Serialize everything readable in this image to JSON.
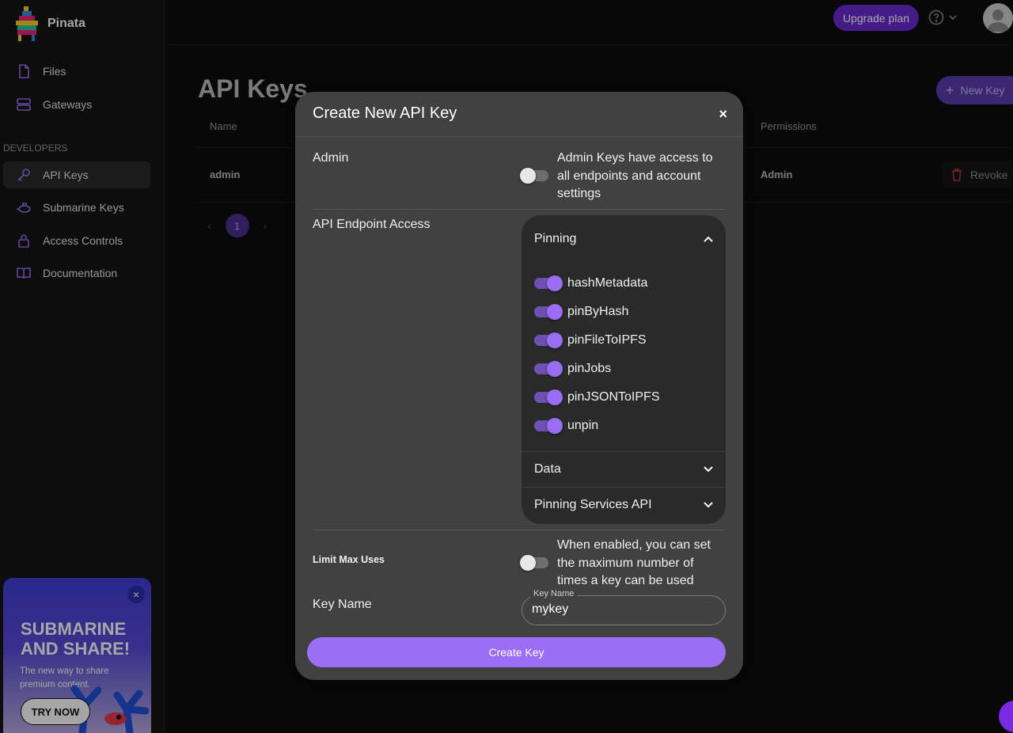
{
  "app": {
    "name": "Pinata",
    "upgrade_label": "Upgrade plan"
  },
  "sidebar": {
    "items": [
      {
        "label": "Files",
        "icon": "file-icon"
      },
      {
        "label": "Gateways",
        "icon": "server-icon"
      }
    ],
    "section_label": "DEVELOPERS",
    "dev_items": [
      {
        "label": "API Keys",
        "icon": "key-icon",
        "active": true
      },
      {
        "label": "Submarine Keys",
        "icon": "submarine-icon"
      },
      {
        "label": "Access Controls",
        "icon": "lock-icon"
      },
      {
        "label": "Documentation",
        "icon": "book-icon"
      }
    ]
  },
  "promo": {
    "title_line1": "SUBMARINE",
    "title_line2": "AND SHARE!",
    "subtitle": "The new way to share premium content.",
    "button": "TRY NOW",
    "close": "×"
  },
  "page": {
    "title": "API Keys",
    "new_key_label": "New Key",
    "columns": [
      "Name",
      "Permissions"
    ],
    "rows": [
      {
        "name": "admin",
        "permissions": "Admin",
        "action": "Revoke"
      }
    ],
    "pager": {
      "current": "1"
    }
  },
  "modal": {
    "title": "Create New API Key",
    "close": "×",
    "admin": {
      "label": "Admin",
      "description": "Admin Keys have access to all endpoints and account settings",
      "enabled": false
    },
    "endpoint_label": "API Endpoint Access",
    "groups": [
      {
        "name": "Pinning",
        "expanded": true,
        "permissions": [
          {
            "name": "hashMetadata",
            "enabled": true
          },
          {
            "name": "pinByHash",
            "enabled": true
          },
          {
            "name": "pinFileToIPFS",
            "enabled": true
          },
          {
            "name": "pinJobs",
            "enabled": true
          },
          {
            "name": "pinJSONToIPFS",
            "enabled": true
          },
          {
            "name": "unpin",
            "enabled": true
          }
        ]
      },
      {
        "name": "Data",
        "expanded": false
      },
      {
        "name": "Pinning Services API",
        "expanded": false
      }
    ],
    "limit": {
      "label": "Limit Max Uses",
      "description": "When enabled, you can set the maximum number of times a key can be used",
      "enabled": false
    },
    "key_name": {
      "label": "Key Name",
      "field_legend": "Key Name",
      "value": "mykey"
    },
    "create_label": "Create Key"
  },
  "colors": {
    "accent": "#9c6ef5",
    "upgrade": "#6b2ad4",
    "modal_bg": "#414141"
  }
}
